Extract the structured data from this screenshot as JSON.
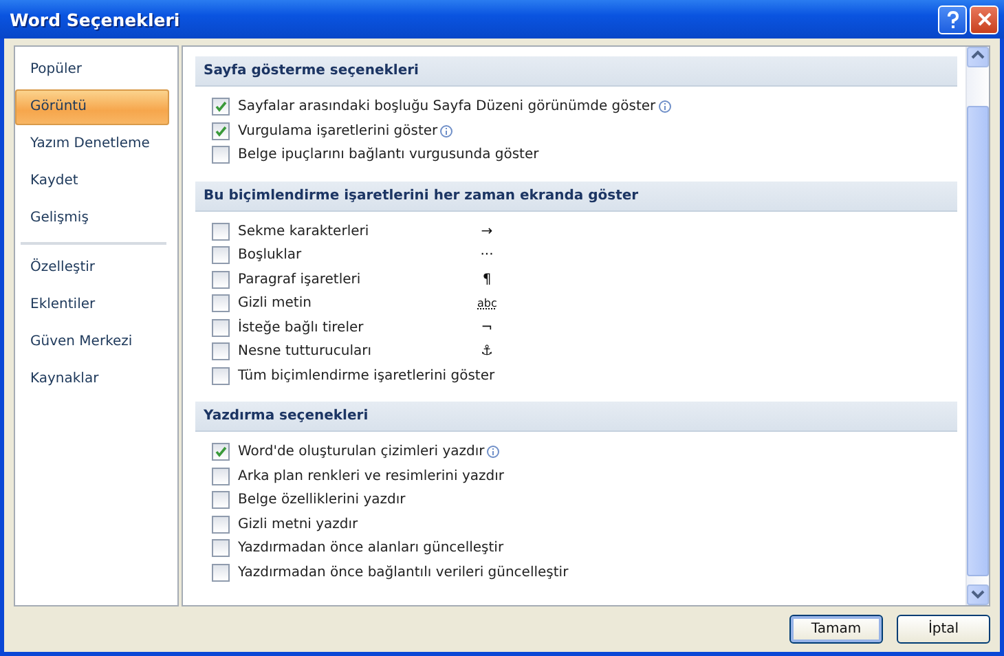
{
  "window": {
    "title": "Word Seçenekleri"
  },
  "sidebar": {
    "groups": [
      [
        {
          "label": "Popüler",
          "selected": false
        },
        {
          "label": "Görüntü",
          "selected": true
        },
        {
          "label": "Yazım Denetleme",
          "selected": false
        },
        {
          "label": "Kaydet",
          "selected": false
        },
        {
          "label": "Gelişmiş",
          "selected": false
        }
      ],
      [
        {
          "label": "Özelleştir",
          "selected": false
        },
        {
          "label": "Eklentiler",
          "selected": false
        },
        {
          "label": "Güven Merkezi",
          "selected": false
        },
        {
          "label": "Kaynaklar",
          "selected": false
        }
      ]
    ]
  },
  "sections": [
    {
      "title": "Sayfa gösterme seçenekleri",
      "options": [
        {
          "label": "Sayfalar arasındaki boşluğu Sayfa Düzeni görünümde göster",
          "checked": true,
          "info": true
        },
        {
          "label": "Vurgulama işaretlerini göster",
          "checked": true,
          "info": true
        },
        {
          "label": "Belge ipuçlarını bağlantı vurgusunda göster",
          "checked": false,
          "info": false
        }
      ]
    },
    {
      "title": "Bu biçimlendirme işaretlerini her zaman ekranda göster",
      "options": [
        {
          "label": "Sekme karakterleri",
          "checked": false,
          "info": false,
          "mark": "→"
        },
        {
          "label": "Boşluklar",
          "checked": false,
          "info": false,
          "mark": "···"
        },
        {
          "label": "Paragraf işaretleri",
          "checked": false,
          "info": false,
          "mark": "¶"
        },
        {
          "label": "Gizli metin",
          "checked": false,
          "info": false,
          "mark": "abc"
        },
        {
          "label": "İsteğe bağlı tireler",
          "checked": false,
          "info": false,
          "mark": "¬"
        },
        {
          "label": "Nesne tutturucuları",
          "checked": false,
          "info": false,
          "mark": "⚓"
        },
        {
          "label": "Tüm biçimlendirme işaretlerini göster",
          "checked": false,
          "info": false
        }
      ]
    },
    {
      "title": "Yazdırma seçenekleri",
      "options": [
        {
          "label": "Word'de oluşturulan çizimleri yazdır",
          "checked": true,
          "info": true
        },
        {
          "label": "Arka plan renkleri ve resimlerini yazdır",
          "checked": false,
          "info": false
        },
        {
          "label": "Belge özelliklerini yazdır",
          "checked": false,
          "info": false
        },
        {
          "label": "Gizli metni yazdır",
          "checked": false,
          "info": false
        },
        {
          "label": "Yazdırmadan önce alanları güncelleştir",
          "checked": false,
          "info": false
        },
        {
          "label": "Yazdırmadan önce bağlantılı verileri güncelleştir",
          "checked": false,
          "info": false
        }
      ]
    }
  ],
  "buttons": [
    {
      "label": "Tamam",
      "default": true
    },
    {
      "label": "İptal",
      "default": false
    }
  ]
}
